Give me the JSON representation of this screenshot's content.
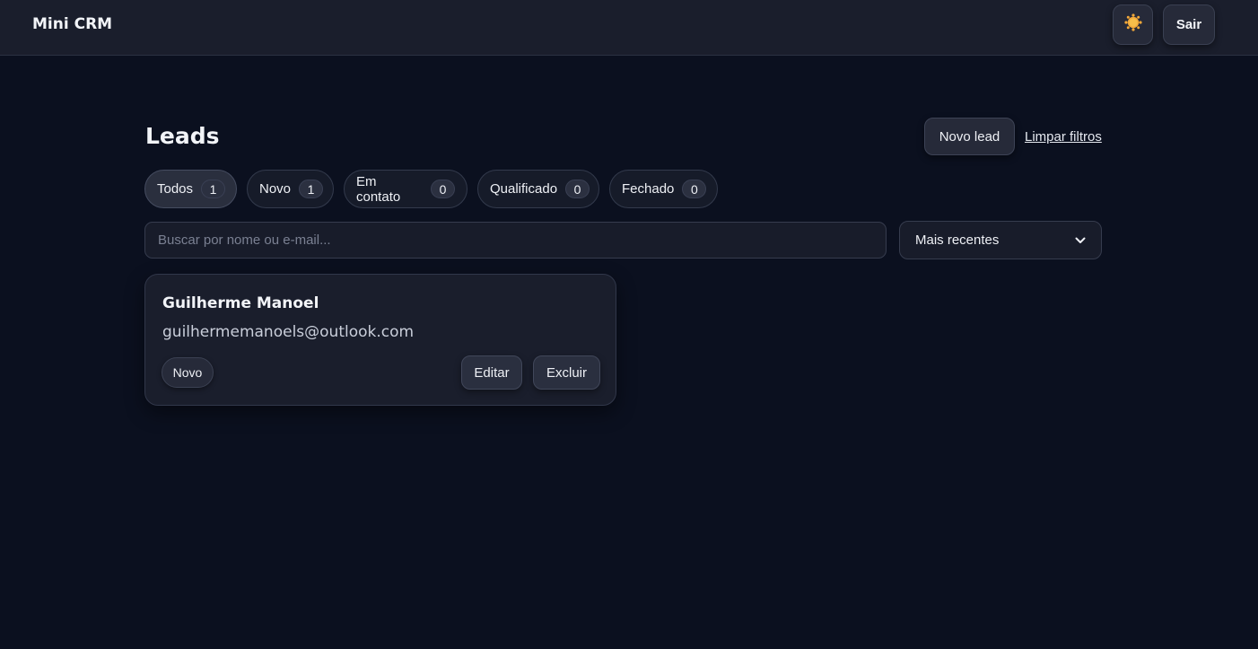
{
  "app": {
    "brand": "Mini CRM"
  },
  "header": {
    "theme_icon": "sun-icon",
    "logout_label": "Sair"
  },
  "page": {
    "title": "Leads",
    "new_lead_label": "Novo lead",
    "clear_filters_label": "Limpar filtros"
  },
  "filters": [
    {
      "label": "Todos",
      "count": "1",
      "active": true
    },
    {
      "label": "Novo",
      "count": "1",
      "active": false
    },
    {
      "label": "Em contato",
      "count": "0",
      "active": false
    },
    {
      "label": "Qualificado",
      "count": "0",
      "active": false
    },
    {
      "label": "Fechado",
      "count": "0",
      "active": false
    }
  ],
  "search": {
    "placeholder": "Buscar por nome ou e-mail...",
    "value": ""
  },
  "sort": {
    "selected": "Mais recentes",
    "icon": "chevron-down-icon"
  },
  "leads": [
    {
      "name": "Guilherme Manoel",
      "email": "guilhermemanoels@outlook.com",
      "status": "Novo",
      "edit_label": "Editar",
      "delete_label": "Excluir"
    }
  ],
  "colors": {
    "background": "#0b101f",
    "surface": "#1a1e2c",
    "sun": "#f5a623"
  }
}
